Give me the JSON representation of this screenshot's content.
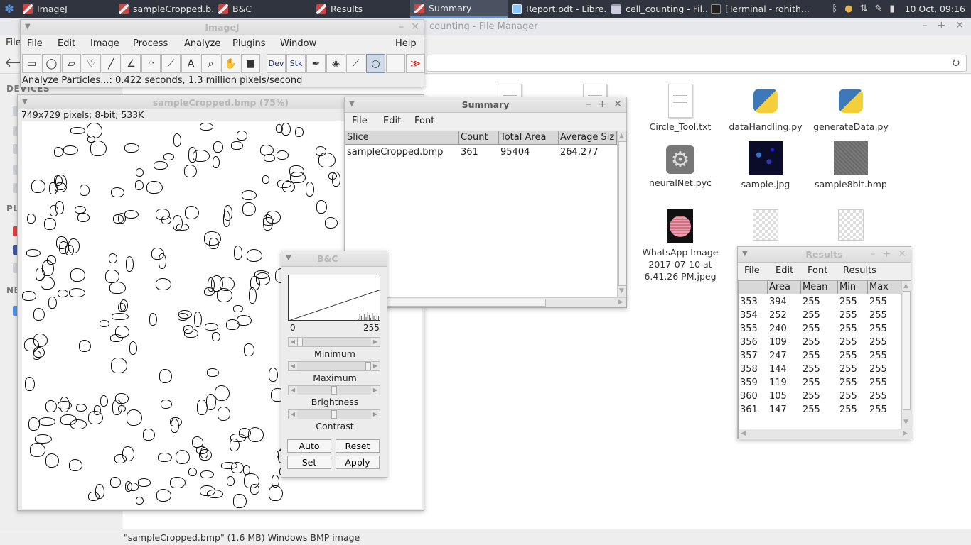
{
  "taskbar": {
    "tasks": [
      {
        "label": "ImageJ"
      },
      {
        "label": "sampleCropped.b..."
      },
      {
        "label": "B&C"
      },
      {
        "label": "Results"
      },
      {
        "label": "Summary"
      },
      {
        "label": "Report.odt - Libre..."
      },
      {
        "label": "cell_counting - Fil..."
      },
      {
        "label": "[Terminal - rohith..."
      }
    ],
    "clock": "10 Oct, 09:16"
  },
  "filemanager": {
    "title": "counting - File Manager",
    "menu_file": "File",
    "sidebar": {
      "devices": "DEVICES",
      "places": "PL",
      "network": "NE"
    },
    "files": [
      {
        "name": "Circle_Tool.txt"
      },
      {
        "name": "dataHandling.py"
      },
      {
        "name": "generateData.py"
      },
      {
        "name": "neuralNet.pyc"
      },
      {
        "name": "sample.jpg"
      },
      {
        "name": "sample8bit.bmp"
      },
      {
        "name": "WhatsApp Image 2017-07-10 at 6.41.26 PM.jpeg"
      }
    ],
    "partial_label": "t",
    "status": "\"sampleCropped.bmp\" (1.6 MB) Windows BMP image"
  },
  "imagej": {
    "title": "ImageJ",
    "menu": [
      "File",
      "Edit",
      "Image",
      "Process",
      "Analyze",
      "Plugins",
      "Window",
      "Help"
    ],
    "tools": {
      "dev": "Dev",
      "stk": "Stk"
    },
    "status": "Analyze Particles...: 0.422 seconds, 1.3 million pixels/second"
  },
  "image_window": {
    "title": "sampleCropped.bmp (75%)",
    "info": "749x729 pixels; 8-bit; 533K"
  },
  "bc": {
    "title": "B&C",
    "range_min": "0",
    "range_max": "255",
    "labels": [
      "Minimum",
      "Maximum",
      "Brightness",
      "Contrast"
    ],
    "buttons": {
      "auto": "Auto",
      "reset": "Reset",
      "set": "Set",
      "apply": "Apply"
    }
  },
  "summary": {
    "title": "Summary",
    "menu": [
      "File",
      "Edit",
      "Font"
    ],
    "columns": [
      "Slice",
      "Count",
      "Total Area",
      "Average Siz"
    ],
    "rows": [
      [
        "sampleCropped.bmp",
        "361",
        "95404",
        "264.277"
      ]
    ]
  },
  "results": {
    "title": "Results",
    "menu": [
      "File",
      "Edit",
      "Font",
      "Results"
    ],
    "columns": [
      "",
      "Area",
      "Mean",
      "Min",
      "Max"
    ],
    "rows": [
      [
        "353",
        "394",
        "255",
        "255",
        "255"
      ],
      [
        "354",
        "252",
        "255",
        "255",
        "255"
      ],
      [
        "355",
        "240",
        "255",
        "255",
        "255"
      ],
      [
        "356",
        "109",
        "255",
        "255",
        "255"
      ],
      [
        "357",
        "247",
        "255",
        "255",
        "255"
      ],
      [
        "358",
        "144",
        "255",
        "255",
        "255"
      ],
      [
        "359",
        "119",
        "255",
        "255",
        "255"
      ],
      [
        "360",
        "105",
        "255",
        "255",
        "255"
      ],
      [
        "361",
        "147",
        "255",
        "255",
        "255"
      ]
    ]
  }
}
